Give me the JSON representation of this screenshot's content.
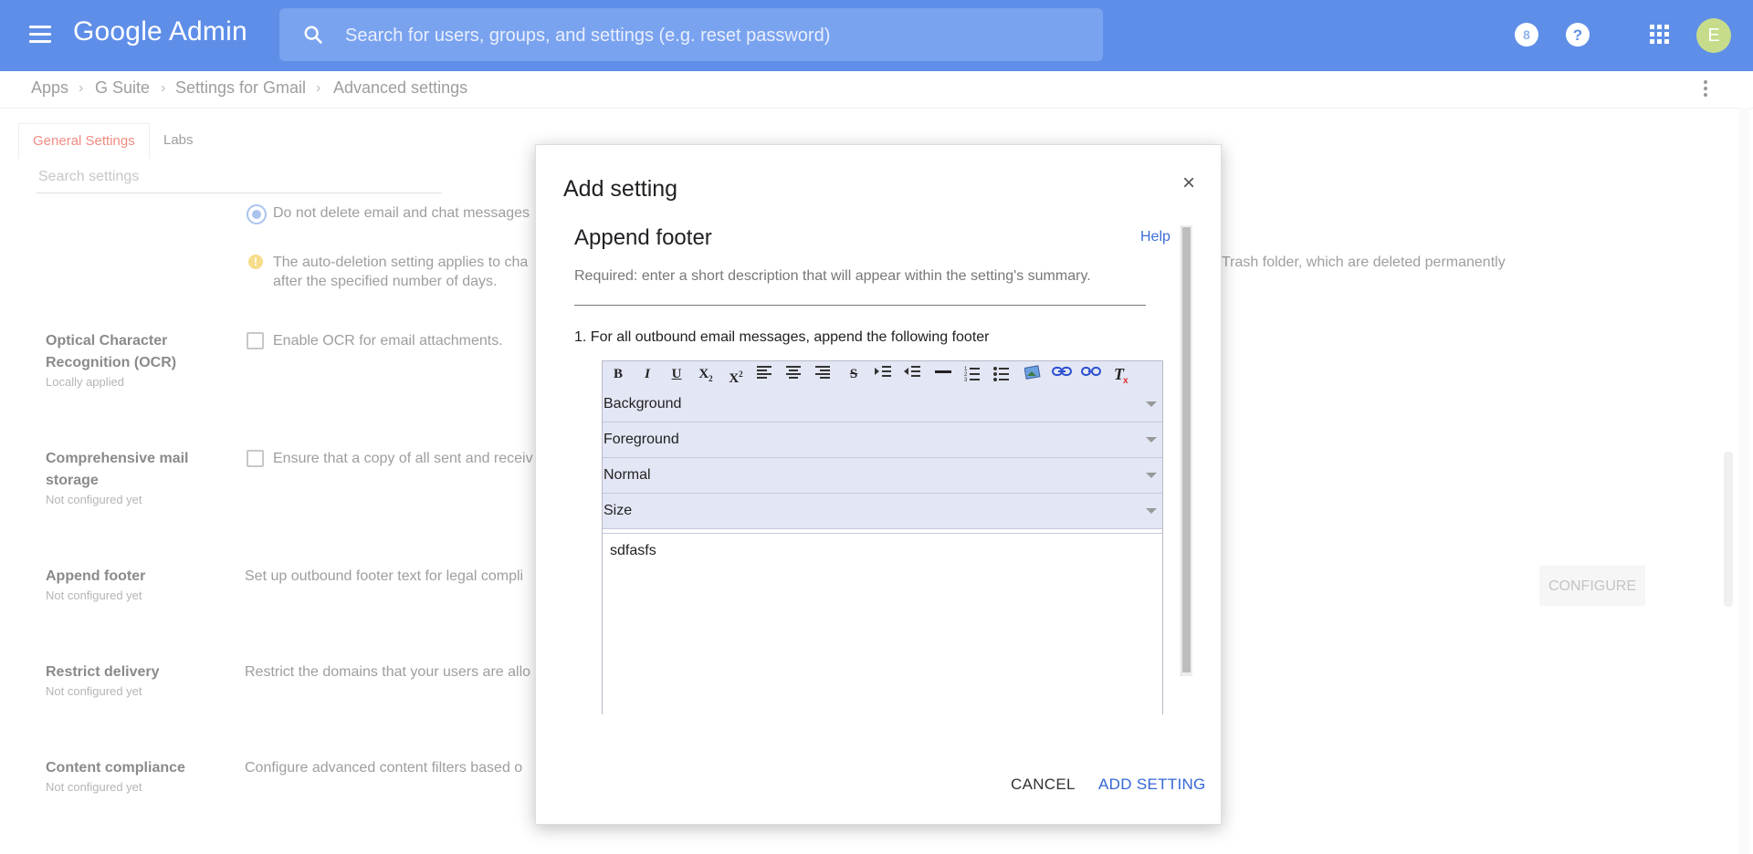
{
  "header": {
    "brand": "Google Admin",
    "search_placeholder": "Search for users, groups, and settings (e.g. reset password)",
    "avatar_initial": "E",
    "icons": [
      "menu-icon",
      "search-icon",
      "alert-icon",
      "help-icon",
      "apps-icon"
    ]
  },
  "breadcrumb": [
    "Apps",
    "G Suite",
    "Settings for Gmail",
    "Advanced settings"
  ],
  "tabs": [
    "General Settings",
    "Labs"
  ],
  "search_settings_placeholder": "Search settings",
  "background": {
    "radio_option": "Do not delete email and chat messages",
    "info_text_1": "The auto-deletion setting applies to cha",
    "info_text_right": "Trash folder, which are deleted permanently",
    "info_text_2": "after the specified number of days.",
    "sections": [
      {
        "title_1": "Optical Character",
        "title_2": "Recognition (OCR)",
        "status": "Locally applied",
        "text": "Enable OCR for email attachments."
      },
      {
        "title_1": "Comprehensive mail",
        "title_2": "storage",
        "status": "Not configured yet",
        "text": "Ensure that a copy of all sent and receiv"
      },
      {
        "title_1": "Append footer",
        "status": "Not configured yet",
        "text": "Set up outbound footer text for legal compli"
      },
      {
        "title_1": "Restrict delivery",
        "status": "Not configured yet",
        "text": "Restrict the domains that your users are allo"
      },
      {
        "title_1": "Content compliance",
        "status": "Not configured yet",
        "text": "Configure advanced content filters based o"
      }
    ],
    "configure_label": "CONFIGURE"
  },
  "dialog": {
    "title": "Add setting",
    "close": "×",
    "section_title": "Append footer",
    "help": "Help",
    "required_text": "Required: enter a short description that will appear within the setting's summary.",
    "step_text": "1. For all outbound email messages, append the following footer",
    "toolbar_tools": [
      "bold-icon",
      "italic-icon",
      "underline-icon",
      "subscript-icon",
      "superscript-icon",
      "align-left-icon",
      "align-center-icon",
      "align-right-icon",
      "strikethrough-icon",
      "indent-icon",
      "outdent-icon",
      "horizontal-rule-icon",
      "numbered-list-icon",
      "bulleted-list-icon",
      "image-icon",
      "link-icon",
      "unlink-icon",
      "clear-format-icon"
    ],
    "selects": [
      "Background",
      "Foreground",
      "Normal",
      "Size"
    ],
    "editor_text": "sdfasfs",
    "cancel_label": "CANCEL",
    "add_label": "ADD SETTING"
  }
}
